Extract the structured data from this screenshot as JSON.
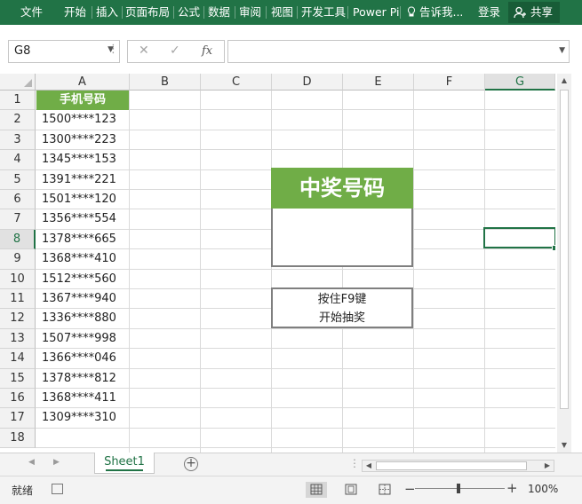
{
  "ribbon": {
    "tabs": [
      "文件",
      "开始",
      "插入",
      "页面布局",
      "公式",
      "数据",
      "审阅",
      "视图",
      "开发工具",
      "Power Pi"
    ],
    "tell_me": "告诉我...",
    "login": "登录",
    "share": "共享"
  },
  "formula_bar": {
    "name_box": "G8",
    "cancel": "✕",
    "enter": "✓",
    "fx": "fx",
    "formula": ""
  },
  "grid": {
    "columns": [
      "A",
      "B",
      "C",
      "D",
      "E",
      "F",
      "G"
    ],
    "selected_column": "G",
    "rows": [
      "1",
      "2",
      "3",
      "4",
      "5",
      "6",
      "7",
      "8",
      "9",
      "10",
      "11",
      "12",
      "13",
      "14",
      "15",
      "16",
      "17",
      "18"
    ],
    "selected_row": "8",
    "a1_header": "手机号码",
    "phone_numbers": [
      "1500****123",
      "1300****223",
      "1345****153",
      "1391****221",
      "1501****120",
      "1356****554",
      "1378****665",
      "1368****410",
      "1512****560",
      "1367****940",
      "1336****880",
      "1507****998",
      "1366****046",
      "1378****812",
      "1368****411",
      "1309****310"
    ],
    "prize_title": "中奖号码",
    "prize_value": "",
    "instruction_line1": "按住F9键",
    "instruction_line2": "开始抽奖",
    "accent_color": "#70ad47"
  },
  "sheets": {
    "tabs": [
      "Sheet1"
    ],
    "active": "Sheet1",
    "add": "+"
  },
  "status": {
    "ready": "就绪",
    "zoom": "100%",
    "zoom_minus": "−",
    "zoom_plus": "+"
  },
  "theme": {
    "ribbon_color": "#217346",
    "share_button_color": "#185c37"
  }
}
